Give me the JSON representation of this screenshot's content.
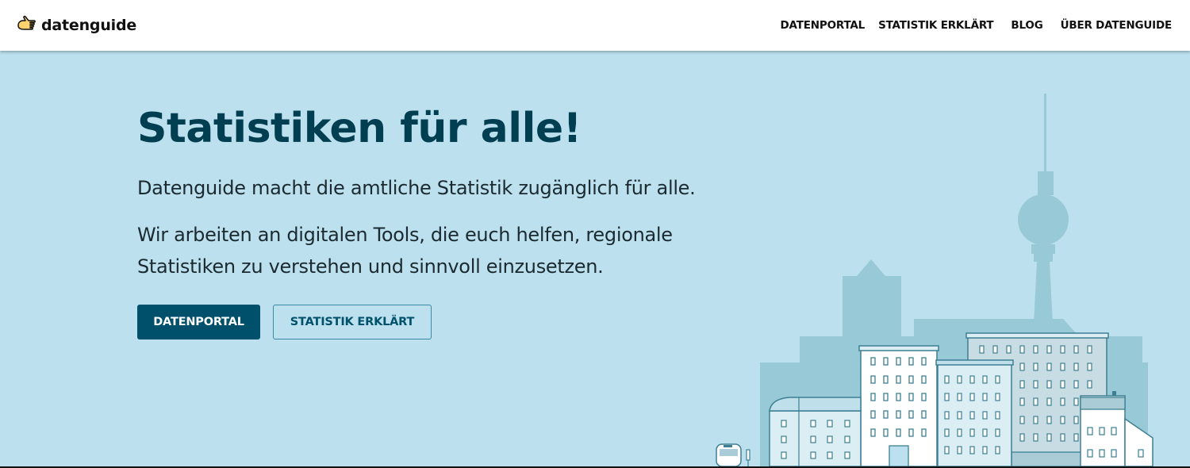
{
  "header": {
    "brand": "datenguide",
    "nav": [
      {
        "label": "DATENPORTAL"
      },
      {
        "label": "STATISTIK ERKLÄRT"
      },
      {
        "label": "BLOG"
      },
      {
        "label": "ÜBER DATENGUIDE"
      }
    ]
  },
  "hero": {
    "title": "Statistiken für alle!",
    "lead1": "Datenguide macht die amtliche Statistik zugänglich für alle.",
    "lead2": "Wir arbeiten an digitalen Tools, die euch helfen, regionale Statistiken zu verstehen und sinnvoll einzusetzen.",
    "primary_button": "DATENPORTAL",
    "secondary_button": "STATISTIK ERKLÄRT"
  },
  "illustration": {
    "icon": "city-skyline-with-tv-tower"
  },
  "colors": {
    "hero_bg": "#bce0ee",
    "title": "#003f52",
    "primary_button": "#004f6b",
    "skyline": "#98c9d6"
  }
}
